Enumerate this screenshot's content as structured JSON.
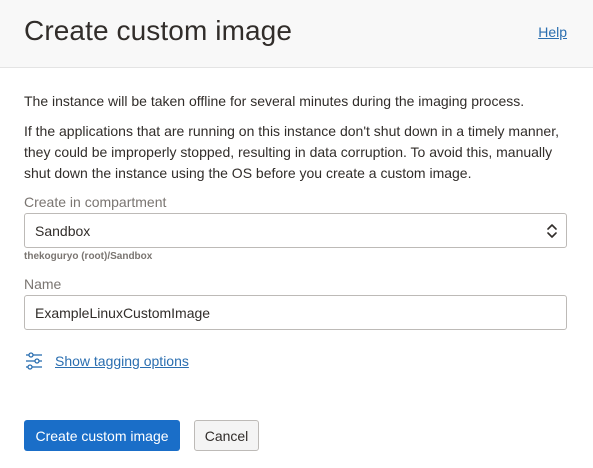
{
  "header": {
    "title": "Create custom image",
    "help_label": "Help"
  },
  "body": {
    "intro": "The instance will be taken offline for several minutes during the imaging process.",
    "warning": "If the applications that are running on this instance don't shut down in a timely manner, they could be improperly stopped, resulting in data corruption. To avoid this, manually shut down the instance using the OS before you create a custom image."
  },
  "form": {
    "compartment_label": "Create in compartment",
    "compartment_value": "Sandbox",
    "compartment_path": "thekoguryo (root)/Sandbox",
    "name_label": "Name",
    "name_value": "ExampleLinuxCustomImage",
    "tagging_link": "Show tagging options"
  },
  "actions": {
    "create_label": "Create custom image",
    "cancel_label": "Cancel"
  },
  "colors": {
    "primary": "#1a6ec8",
    "link": "#2a6eb0"
  },
  "icons": {
    "select_chevron": "up-down-chevron-icon",
    "tagging": "sliders-icon"
  }
}
